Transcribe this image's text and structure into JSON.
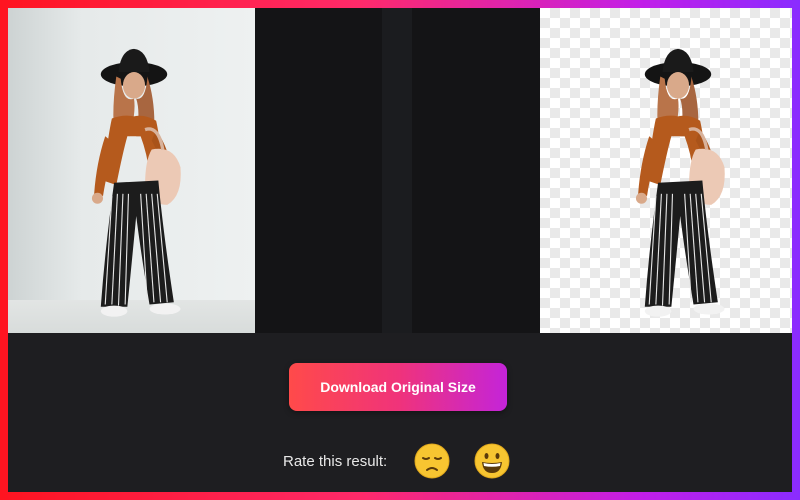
{
  "actions": {
    "download_label": "Download Original Size"
  },
  "rating": {
    "label": "Rate this result:",
    "options": [
      {
        "name": "sad-face",
        "value": "dislike"
      },
      {
        "name": "grinning-face",
        "value": "like"
      }
    ]
  },
  "colors": {
    "border_gradient": [
      "#ff1420",
      "#ff2a6a",
      "#c21ee8",
      "#8a2cff"
    ],
    "button_gradient": [
      "#ff4a4a",
      "#f0337a",
      "#c424d9"
    ],
    "background": "#1e1e21"
  },
  "icons": {
    "sad": "pensive-face-icon",
    "happy": "grinning-face-icon"
  }
}
